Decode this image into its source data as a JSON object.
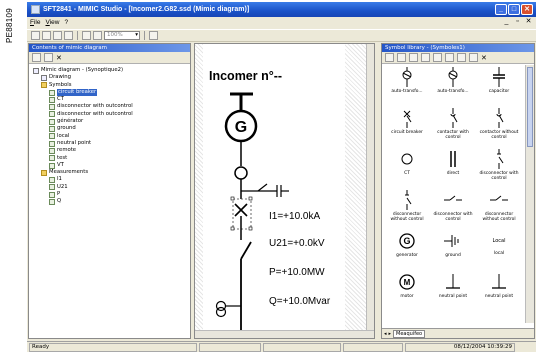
{
  "figure_code": "PE88109",
  "window": {
    "title": "SFT2841 - MIMIC Studio - [Incomer2.G82.ssd (Mimic diagram)]"
  },
  "menu": [
    {
      "prefix": "",
      "accel": "F",
      "rest": "ile"
    },
    {
      "prefix": "",
      "accel": "V",
      "rest": "iew"
    },
    {
      "prefix": "",
      "accel": "",
      "rest": "?"
    }
  ],
  "mdi_buttons": [
    "_",
    "▫",
    "✕"
  ],
  "title_buttons": [
    "_",
    "□",
    "✕"
  ],
  "toolbar": {
    "zoom": "100%"
  },
  "left_panel": {
    "title": "Contents of mimic diagram",
    "tree": [
      {
        "label": "Mimic diagram - (Synoptique2)",
        "level": 0,
        "icon": "doc"
      },
      {
        "label": "Drawing",
        "level": 1,
        "icon": "doc"
      },
      {
        "label": "Symbols",
        "level": 1,
        "icon": "folder"
      },
      {
        "label": "circuit breaker",
        "level": 2,
        "icon": "leaf",
        "selected": true
      },
      {
        "label": "CT",
        "level": 2,
        "icon": "leaf"
      },
      {
        "label": "disconnector with outcontrol",
        "level": 2,
        "icon": "leaf"
      },
      {
        "label": "disconnector with outcontrol",
        "level": 2,
        "icon": "leaf"
      },
      {
        "label": "générator",
        "level": 2,
        "icon": "leaf"
      },
      {
        "label": "ground",
        "level": 2,
        "icon": "leaf"
      },
      {
        "label": "local",
        "level": 2,
        "icon": "leaf"
      },
      {
        "label": "neutral point",
        "level": 2,
        "icon": "leaf"
      },
      {
        "label": "remote",
        "level": 2,
        "icon": "leaf"
      },
      {
        "label": "test",
        "level": 2,
        "icon": "leaf"
      },
      {
        "label": "VT",
        "level": 2,
        "icon": "leaf"
      },
      {
        "label": "Measurements",
        "level": 1,
        "icon": "folder"
      },
      {
        "label": "I1",
        "level": 2,
        "icon": "leaf"
      },
      {
        "label": "U21",
        "level": 2,
        "icon": "leaf"
      },
      {
        "label": "P",
        "level": 2,
        "icon": "leaf"
      },
      {
        "label": "Q",
        "level": 2,
        "icon": "leaf"
      }
    ]
  },
  "diagram": {
    "title": "Incomer n°--",
    "measurements": [
      "I1=+10.0kA",
      "U21=+0.0kV",
      "P=+10.0MW",
      "Q=+10.0Mvar"
    ]
  },
  "right_panel": {
    "title": "Symbol library - (Symboles1)",
    "symbols": [
      {
        "label": "auto-transfo...",
        "icon": "auto-transformer-icon"
      },
      {
        "label": "auto-transfo...",
        "icon": "auto-transformer-icon"
      },
      {
        "label": "capacitor",
        "icon": "capacitor-icon"
      },
      {
        "label": "circuit breaker",
        "icon": "circuit-breaker-icon"
      },
      {
        "label": "contactor with control",
        "icon": "contactor-icon"
      },
      {
        "label": "contactor without control",
        "icon": "contactor-icon"
      },
      {
        "label": "CT",
        "icon": "ct-icon"
      },
      {
        "label": "direct",
        "icon": "direct-icon"
      },
      {
        "label": "disconnector with control",
        "icon": "disconnector-icon"
      },
      {
        "label": "disconnector without control",
        "icon": "disconnector-icon"
      },
      {
        "label": "disconnector with control",
        "icon": "disconnector-h-icon"
      },
      {
        "label": "disconnector without control",
        "icon": "disconnector-h-icon"
      },
      {
        "label": "generator",
        "icon": "generator-icon"
      },
      {
        "label": "ground",
        "icon": "ground-icon"
      },
      {
        "label": "local",
        "icon": "local-icon",
        "inner_text": "Local"
      },
      {
        "label": "motor",
        "icon": "motor-icon"
      },
      {
        "label": "neutral point",
        "icon": "neutral-point-icon"
      },
      {
        "label": "neutral point",
        "icon": "neutral-point-icon"
      }
    ],
    "tab_label": "Meaquifeo"
  },
  "statusbar": {
    "text": "Ready",
    "datetime": "08/12/2004 10:39:29"
  }
}
